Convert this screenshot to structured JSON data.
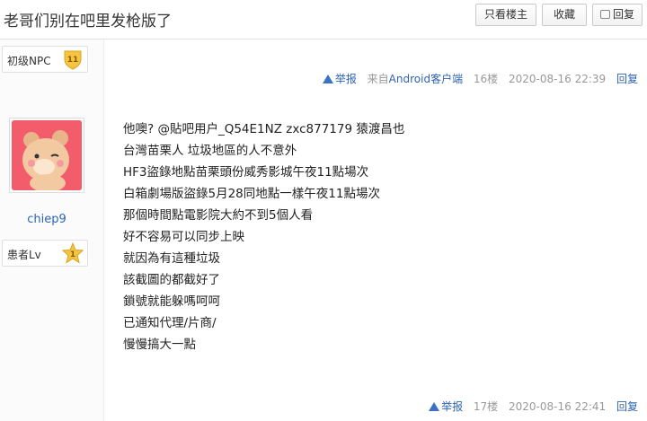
{
  "header": {
    "title": "老哥们别在吧里发枪版了",
    "only_author": "只看楼主",
    "favorite": "收藏",
    "reply": "回复"
  },
  "floor16": {
    "level_name": "初级NPC",
    "level_num": "11",
    "report": "举报",
    "client_prefix": "来自",
    "client_link": "Android客户端",
    "floor": "16楼",
    "time": "2020-08-16 22:39",
    "reply": "回复"
  },
  "floor17": {
    "username": "chiep9",
    "level_name": "患者Lv",
    "level_num": "1",
    "lines": [
      "他噢? @貼吧用户_Q54E1NZ zxc877179 猿渡昌也",
      "台灣苗栗人 垃圾地區的人不意外",
      "HF3盜錄地點苗栗頭份威秀影城午夜11點場次",
      "白箱劇場版盜錄5月28同地點一樣午夜11點場次",
      "那個時間點電影院大約不到5個人看",
      "好不容易可以同步上映",
      "就因為有這種垃圾",
      "該截圖的都截好了",
      "鎖號就能躲嗎呵呵",
      "已通知代理/片商/",
      "慢慢搞大一點"
    ],
    "report": "举报",
    "floor": "17楼",
    "time": "2020-08-16 22:41",
    "reply": "回复"
  },
  "colors": {
    "link": "#2d64b3",
    "meta": "#999999",
    "badge": "#f5c542",
    "avatar_bg": "#f35d6b"
  }
}
